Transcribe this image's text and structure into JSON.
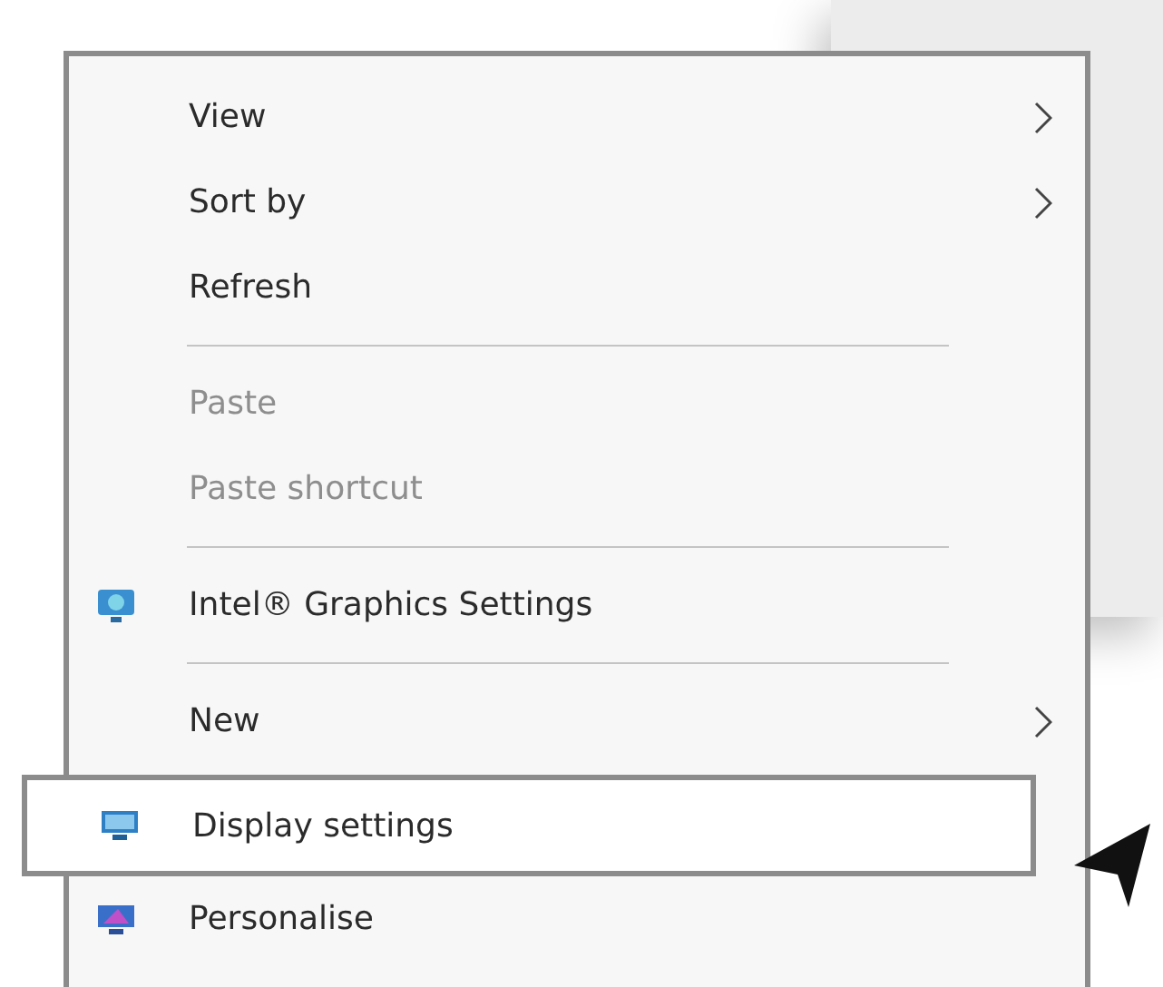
{
  "menu": {
    "items": [
      {
        "kind": "plain",
        "label": "View",
        "disabled": false,
        "submenu": true,
        "selected": false
      },
      {
        "kind": "plain",
        "label": "Sort by",
        "disabled": false,
        "submenu": true,
        "selected": false
      },
      {
        "kind": "plain",
        "label": "Refresh",
        "disabled": false,
        "submenu": false,
        "selected": false
      },
      {
        "kind": "separator"
      },
      {
        "kind": "plain",
        "label": "Paste",
        "disabled": true,
        "submenu": false,
        "selected": false
      },
      {
        "kind": "plain",
        "label": "Paste shortcut",
        "disabled": true,
        "submenu": false,
        "selected": false
      },
      {
        "kind": "separator"
      },
      {
        "kind": "graphics",
        "label": "Intel® Graphics Settings",
        "disabled": false,
        "submenu": false,
        "selected": false
      },
      {
        "kind": "separator"
      },
      {
        "kind": "plain",
        "label": "New",
        "disabled": false,
        "submenu": true,
        "selected": false
      },
      {
        "kind": "display",
        "label": "Display settings",
        "disabled": false,
        "submenu": false,
        "selected": true
      },
      {
        "kind": "personalise",
        "label": "Personalise",
        "disabled": false,
        "submenu": false,
        "selected": false
      }
    ]
  }
}
